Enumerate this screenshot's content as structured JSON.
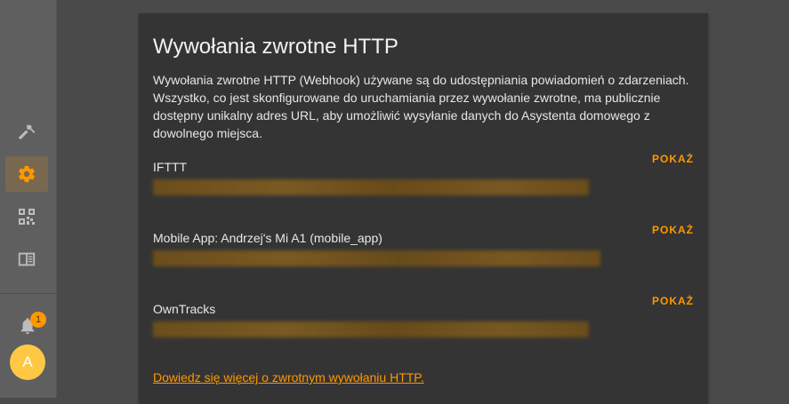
{
  "sidebar": {
    "items": [
      {
        "icon": "hammer-icon"
      },
      {
        "icon": "gear-icon",
        "active": true
      },
      {
        "icon": "qr-code-icon"
      },
      {
        "icon": "book-open-icon"
      }
    ],
    "notifications_count": "1",
    "avatar_initial": "A"
  },
  "webhooks": {
    "title": "Wywołania zwrotne HTTP",
    "description": "Wywołania zwrotne HTTP (Webhook) używane są do udostępniania powiadomień o zdarzeniach. Wszystko, co jest skonfigurowane do uruchamiania przez wywołanie zwrotne, ma publicznie dostępny unikalny adres URL, aby umożliwić wysyłanie danych do Asystenta domowego z dowolnego miejsca.",
    "items": [
      {
        "name": "IFTTT",
        "show_label": "POKAŻ"
      },
      {
        "name": "Mobile App: Andrzej's Mi A1 (mobile_app)",
        "show_label": "POKAŻ"
      },
      {
        "name": "OwnTracks",
        "show_label": "POKAŻ"
      }
    ],
    "learn_more": "Dowiedz się więcej o zwrotnym wywołaniu HTTP."
  },
  "colors": {
    "accent": "#ff9800",
    "avatar": "#ffc844",
    "card": "#343434",
    "sidebar": "#5f5f5f"
  }
}
